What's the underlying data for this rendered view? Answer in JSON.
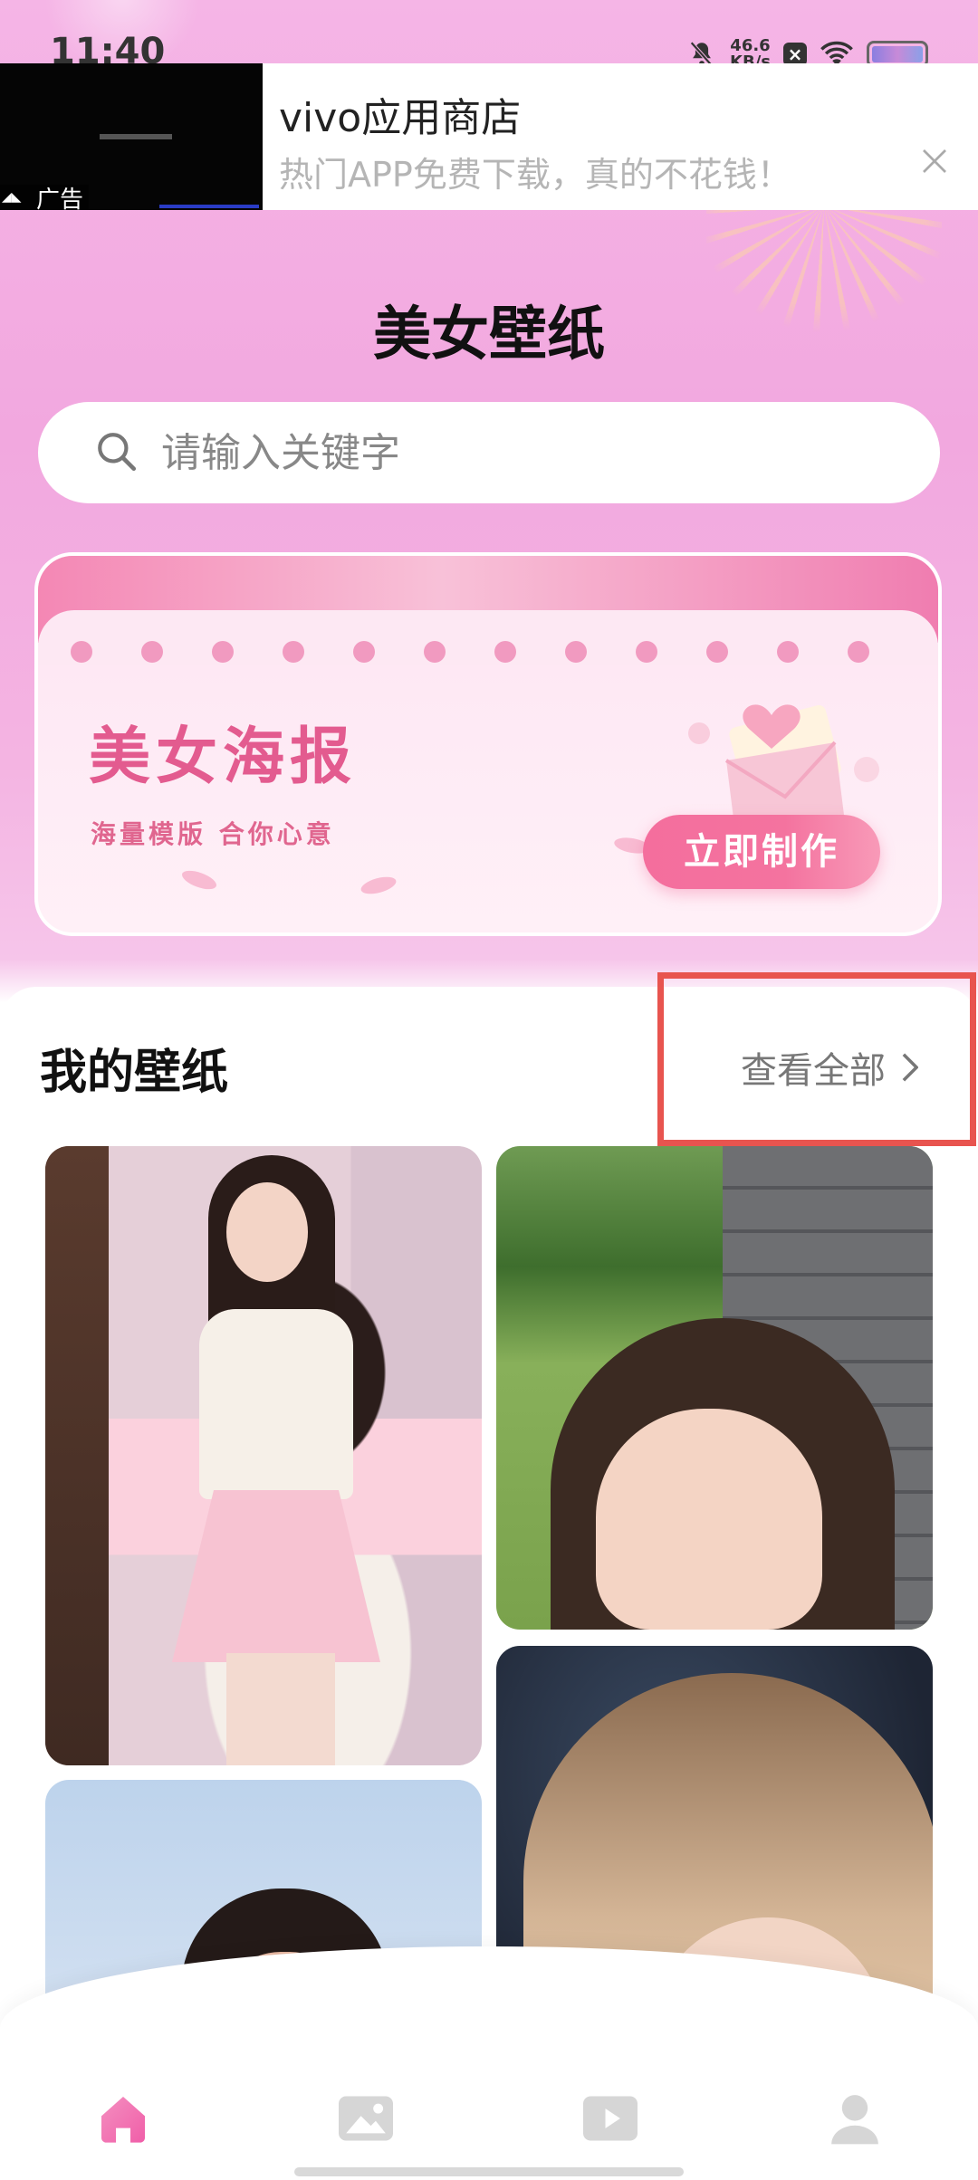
{
  "status_bar": {
    "time": "11:40",
    "net_speed_value": "46.6",
    "net_speed_unit": "KB/s"
  },
  "ad": {
    "tag": "广告",
    "title": "vivo应用商店",
    "subtitle": "热门APP免费下载，真的不花钱！"
  },
  "header": {
    "title": "美女壁纸"
  },
  "search": {
    "placeholder": "请输入关键字"
  },
  "poster_banner": {
    "title": "美女海报",
    "subtitle": "海量模版 合你心意",
    "button_label": "立即制作"
  },
  "my_wallpapers": {
    "title": "我的壁纸",
    "view_all_label": "查看全部"
  },
  "bottom_nav": {
    "items": [
      {
        "icon": "home-icon",
        "active": true
      },
      {
        "icon": "image-icon",
        "active": false
      },
      {
        "icon": "video-icon",
        "active": false
      },
      {
        "icon": "profile-icon",
        "active": false
      }
    ]
  },
  "colors": {
    "accent_pink": "#f46e9d",
    "highlight_red": "#e8544f",
    "nav_inactive": "#d6d6d6"
  }
}
